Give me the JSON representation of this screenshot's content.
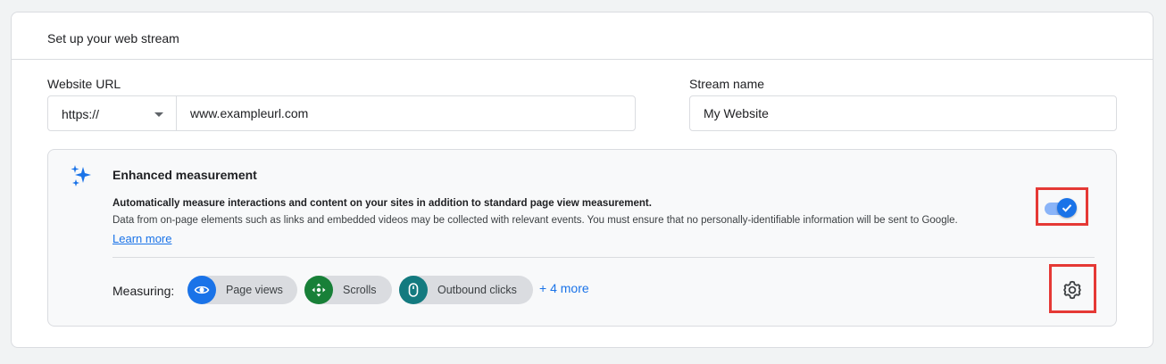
{
  "card": {
    "title": "Set up your web stream"
  },
  "website_url": {
    "label": "Website URL",
    "protocol": "https://",
    "value": "www.exampleurl.com"
  },
  "stream_name": {
    "label": "Stream name",
    "value": "My Website"
  },
  "enhanced": {
    "title": "Enhanced measurement",
    "description": "Automatically measure interactions and content on your sites in addition to standard page view measurement.",
    "note": "Data from on-page elements such as links and embedded videos may be collected with relevant events. You must ensure that no personally-identifiable information will be sent to Google.",
    "learn_more": "Learn more",
    "toggle_on": true,
    "measuring_label": "Measuring:",
    "chips": [
      {
        "label": "Page views",
        "icon": "eye-icon",
        "color": "#1a73e8"
      },
      {
        "label": "Scrolls",
        "icon": "scroll-move-icon",
        "color": "#188038"
      },
      {
        "label": "Outbound clicks",
        "icon": "mouse-icon",
        "color": "#137a7f"
      }
    ],
    "more": "+ 4 more"
  },
  "colors": {
    "accent": "#1a73e8",
    "highlight": "#e53935",
    "border": "#dadce0"
  }
}
